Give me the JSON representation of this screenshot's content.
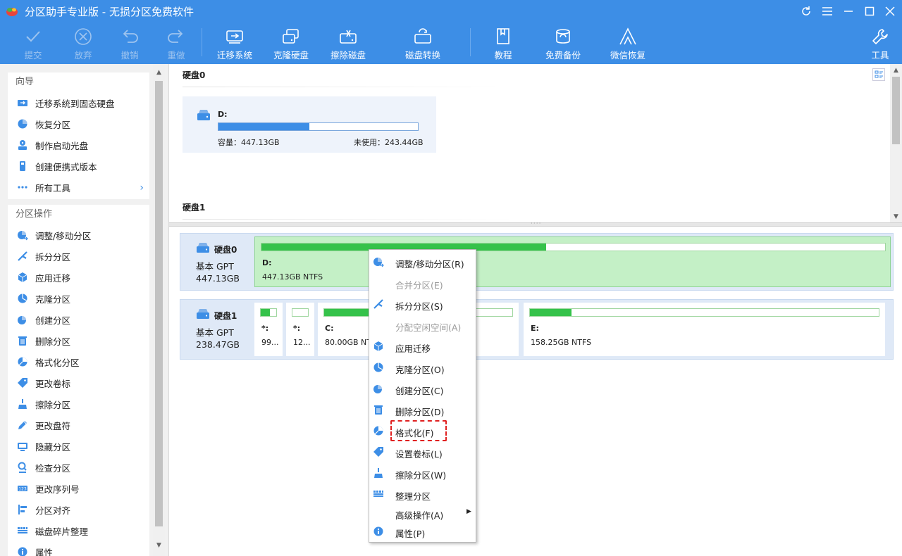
{
  "window": {
    "title": "分区助手专业版 - 无损分区免费软件",
    "controls": [
      "refresh-icon",
      "menu-icon",
      "minimize-icon",
      "maximize-icon",
      "close-icon"
    ]
  },
  "toolbar": {
    "commit": "提交",
    "discard": "放弃",
    "undo": "撤销",
    "redo": "重做",
    "migrate_os": "迁移系统",
    "clone_disk": "克隆硬盘",
    "wipe_disk": "擦除磁盘",
    "disk_convert": "磁盘转换",
    "tutorial": "教程",
    "free_backup": "免费备份",
    "wechat_recovery": "微信恢复",
    "tools": "工具"
  },
  "sidebar": {
    "wizard_title": "向导",
    "wizard_items": [
      {
        "label": "迁移系统到固态硬盘",
        "icon": "migrate-icon"
      },
      {
        "label": "恢复分区",
        "icon": "recover-icon"
      },
      {
        "label": "制作启动光盘",
        "icon": "bootdisk-icon"
      },
      {
        "label": "创建便携式版本",
        "icon": "portable-icon"
      },
      {
        "label": "所有工具",
        "icon": "more-icon"
      }
    ],
    "ops_title": "分区操作",
    "ops_items": [
      {
        "label": "调整/移动分区",
        "icon": "resize-icon"
      },
      {
        "label": "拆分分区",
        "icon": "split-icon"
      },
      {
        "label": "应用迁移",
        "icon": "app-move-icon"
      },
      {
        "label": "克隆分区",
        "icon": "clone-icon"
      },
      {
        "label": "创建分区",
        "icon": "create-icon"
      },
      {
        "label": "删除分区",
        "icon": "delete-icon"
      },
      {
        "label": "格式化分区",
        "icon": "format-icon"
      },
      {
        "label": "更改卷标",
        "icon": "label-icon"
      },
      {
        "label": "擦除分区",
        "icon": "wipe-icon"
      },
      {
        "label": "更改盘符",
        "icon": "drive-letter-icon"
      },
      {
        "label": "隐藏分区",
        "icon": "hide-icon"
      },
      {
        "label": "检查分区",
        "icon": "check-icon"
      },
      {
        "label": "更改序列号",
        "icon": "serial-icon"
      },
      {
        "label": "分区对齐",
        "icon": "align-icon"
      },
      {
        "label": "磁盘碎片整理",
        "icon": "defrag-icon"
      },
      {
        "label": "属性",
        "icon": "props-icon"
      }
    ]
  },
  "upper": {
    "disk0_label": "硬盘0",
    "disk1_label": "硬盘1",
    "partition": {
      "name": "D:",
      "capacity": "容量：447.13GB",
      "unused": "未使用：243.44GB",
      "used_fraction": 0.456
    }
  },
  "disks": [
    {
      "name": "硬盘0",
      "type": "基本 GPT",
      "size": "447.13GB",
      "partitions": [
        {
          "label": "D:",
          "info": "447.13GB NTFS",
          "used_fraction": 0.456
        }
      ]
    },
    {
      "name": "硬盘1",
      "type": "基本 GPT",
      "size": "238.47GB",
      "partitions": [
        {
          "label": "*:",
          "info": "99...",
          "used_fraction": 0.6
        },
        {
          "label": "*:",
          "info": "12...",
          "used_fraction": 0.0
        },
        {
          "label": "C:",
          "info": "80.00GB NTFS",
          "used_fraction": 0.3
        },
        {
          "label": "E:",
          "info": "158.25GB NTFS",
          "used_fraction": 0.12
        }
      ]
    }
  ],
  "context_menu": [
    {
      "label": "调整/移动分区(R)",
      "icon": "resize-icon",
      "enabled": true
    },
    {
      "label": "合并分区(E)",
      "icon": "",
      "enabled": false
    },
    {
      "label": "拆分分区(S)",
      "icon": "split-icon",
      "enabled": true
    },
    {
      "label": "分配空闲空间(A)",
      "icon": "",
      "enabled": false
    },
    {
      "label": "应用迁移",
      "icon": "app-move-icon",
      "enabled": true
    },
    {
      "label": "克隆分区(O)",
      "icon": "clone-icon",
      "enabled": true
    },
    {
      "label": "创建分区(C)",
      "icon": "create-icon",
      "enabled": true
    },
    {
      "label": "删除分区(D)",
      "icon": "delete-icon",
      "enabled": true
    },
    {
      "label": "格式化(F)",
      "icon": "format-icon",
      "enabled": true
    },
    {
      "label": "设置卷标(L)",
      "icon": "label-icon",
      "enabled": true
    },
    {
      "label": "擦除分区(W)",
      "icon": "wipe-icon",
      "enabled": true
    },
    {
      "label": "整理分区",
      "icon": "defrag-icon",
      "enabled": true
    },
    {
      "label": "高级操作(A)",
      "icon": "",
      "enabled": true,
      "submenu": true
    },
    {
      "label": "属性(P)",
      "icon": "info-icon",
      "enabled": true
    }
  ],
  "colors": {
    "accent": "#3d8ee6",
    "partition_used": "#35c24a",
    "highlight": "#e02020"
  }
}
